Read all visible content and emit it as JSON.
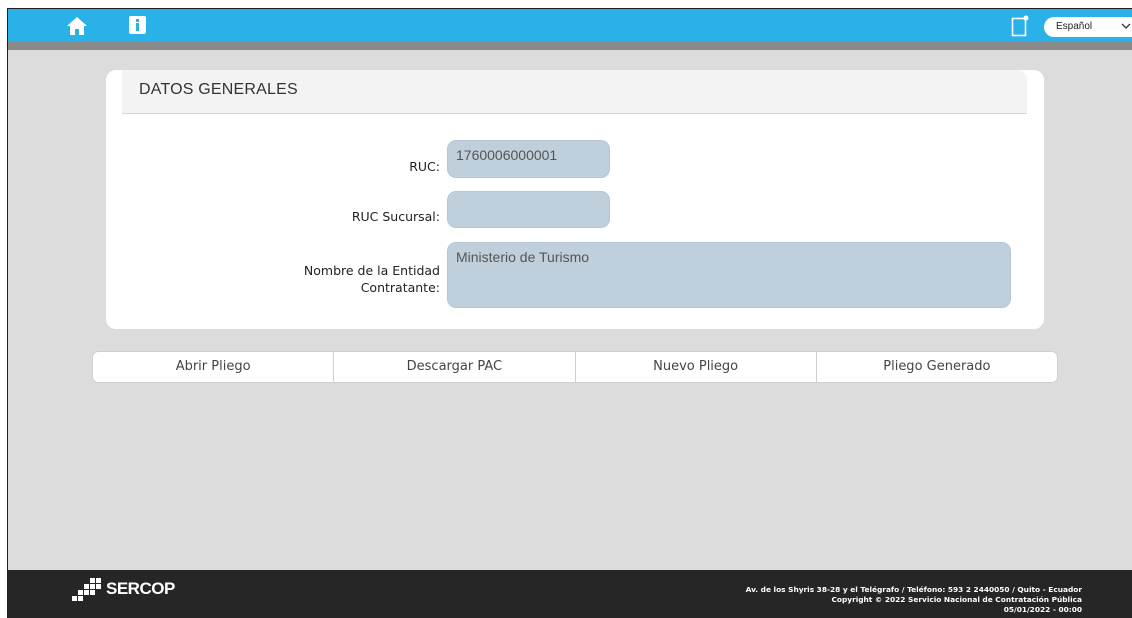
{
  "topbar": {
    "home_icon": "home-icon",
    "info_icon": "info-icon",
    "doc_icon": "document-icon",
    "language": "Español",
    "accent_color": "#2ab2e8"
  },
  "panel": {
    "title": "DATOS GENERALES",
    "fields": [
      {
        "label": "RUC:",
        "value": "1760006000001"
      },
      {
        "label": "RUC Sucursal:",
        "value": ""
      },
      {
        "label_line1": "Nombre de la Entidad",
        "label_line2": "Contratante:",
        "value": "Ministerio de Turismo"
      }
    ]
  },
  "tabs": [
    {
      "label": "Abrir Pliego"
    },
    {
      "label": "Descargar PAC"
    },
    {
      "label": "Nuevo Pliego"
    },
    {
      "label": "Pliego Generado"
    }
  ],
  "footer": {
    "logo_text": "SERCOP",
    "address": "Av. de los Shyris 38-28 y el Telégrafo / Teléfono: 593 2 2440050 / Quito - Ecuador",
    "copyright": "Copyright © 2022 Servicio Nacional de Contratación Pública",
    "datetime": "05/01/2022 - 00:00"
  }
}
